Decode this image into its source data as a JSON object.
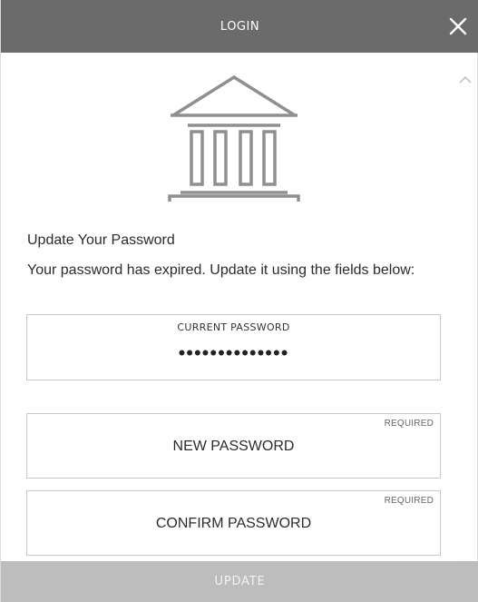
{
  "window": {
    "title": "LOGIN"
  },
  "icons": {
    "close": "close-icon",
    "logo": "bank-building-icon",
    "scroll_up": "chevron-up-icon",
    "scroll_down": "chevron-down-icon"
  },
  "colors": {
    "titlebar_bg": "#6b6b6b",
    "logo_gray": "#8f8f8f",
    "field_border": "#c8c8c8",
    "button_disabled_bg": "#bdbdbd"
  },
  "form": {
    "heading": "Update Your Password",
    "description": "Your password has expired. Update it using the fields below:",
    "current_password": {
      "label": "CURRENT PASSWORD",
      "masked_value": "••••••••••••••"
    },
    "new_password": {
      "placeholder": "NEW PASSWORD",
      "required_label": "REQUIRED"
    },
    "confirm_password": {
      "placeholder": "CONFIRM PASSWORD",
      "required_label": "REQUIRED"
    },
    "submit_label": "UPDATE"
  }
}
